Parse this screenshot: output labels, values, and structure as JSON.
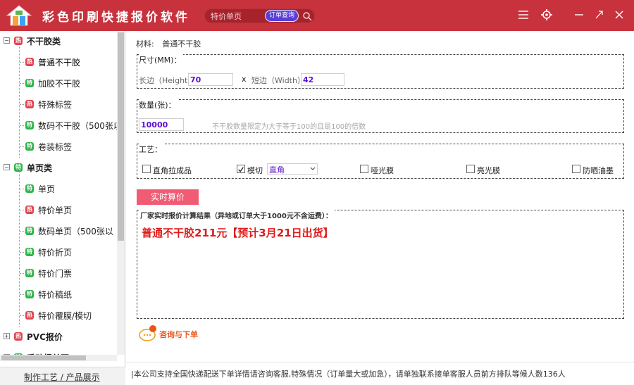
{
  "app": {
    "title": "彩色印刷快捷报价软件",
    "search_placeholder": "特价单页",
    "order_query_label": "订单查询",
    "colors": {
      "titlebar": "#c8323c",
      "accent_button": "#f15b74",
      "result_text": "#e01a1a",
      "input_value": "#5b0fd3"
    },
    "window_icons": [
      "menu-icon",
      "settings-icon",
      "minimize-icon",
      "maximize-icon",
      "close-icon"
    ]
  },
  "sidebar": {
    "items": [
      {
        "level": 0,
        "expander": "−",
        "badge": "red",
        "label": "不干胶类"
      },
      {
        "level": 1,
        "badge": "red",
        "label": "普通不干胶",
        "selected": true
      },
      {
        "level": 1,
        "badge": "green",
        "label": "加胶不干胶"
      },
      {
        "level": 1,
        "badge": "red",
        "label": "特殊标签"
      },
      {
        "level": 1,
        "badge": "green",
        "label": "数码不干胶（500张以"
      },
      {
        "level": 1,
        "badge": "green",
        "label": "卷装标签"
      },
      {
        "level": 0,
        "expander": "−",
        "badge": "green",
        "label": "单页类"
      },
      {
        "level": 1,
        "badge": "green",
        "label": "单页"
      },
      {
        "level": 1,
        "badge": "red",
        "label": "特价单页"
      },
      {
        "level": 1,
        "badge": "green",
        "label": "数码单页（500张以"
      },
      {
        "level": 1,
        "badge": "green",
        "label": "特价折页"
      },
      {
        "level": 1,
        "badge": "green",
        "label": "特价门票"
      },
      {
        "level": 1,
        "badge": "green",
        "label": "特价稿纸"
      },
      {
        "level": 1,
        "badge": "red",
        "label": "特价覆膜/模切"
      },
      {
        "level": 0,
        "expander": "+",
        "badge": "red",
        "label": "PVC报价"
      },
      {
        "level": 0,
        "expander": "+",
        "badge": "green",
        "label": "手动报单页"
      }
    ],
    "footer_link": "制作工艺 / 产品展示"
  },
  "form": {
    "material_label": "材料:",
    "material_value": "普通不干胶",
    "size": {
      "legend": "尺寸(MM)：",
      "length_label": "长边（Height）",
      "length_value": "70",
      "times": "x",
      "width_label": "短边（Width）",
      "width_value": "42"
    },
    "quantity": {
      "legend": "数量(张)：",
      "value": "10000",
      "hint": "不干胶数量限定为大于等于100的且是100的倍数"
    },
    "process": {
      "legend": "工艺：",
      "options": [
        {
          "label": "直角拉成品",
          "checked": false
        },
        {
          "label": "模切",
          "checked": true
        },
        {
          "label": "哑光膜",
          "checked": false
        },
        {
          "label": "亮光膜",
          "checked": false
        },
        {
          "label": "防晒油墨",
          "checked": false
        }
      ],
      "corner_select": "直角"
    },
    "calc_button": "实时算价",
    "result_legend": "厂家实时报价计算结果（异地或订单大于1000元不含运费）：",
    "result_text": "普通不干胶211元【预计3月21日出货】",
    "consult_label": "咨询与下单"
  },
  "marquee": "|本公司支持全国快递配送下单详情请咨询客服,特殊情况（订单量大或加急），请单独联系接单客服人员前方排队等候人数136人"
}
